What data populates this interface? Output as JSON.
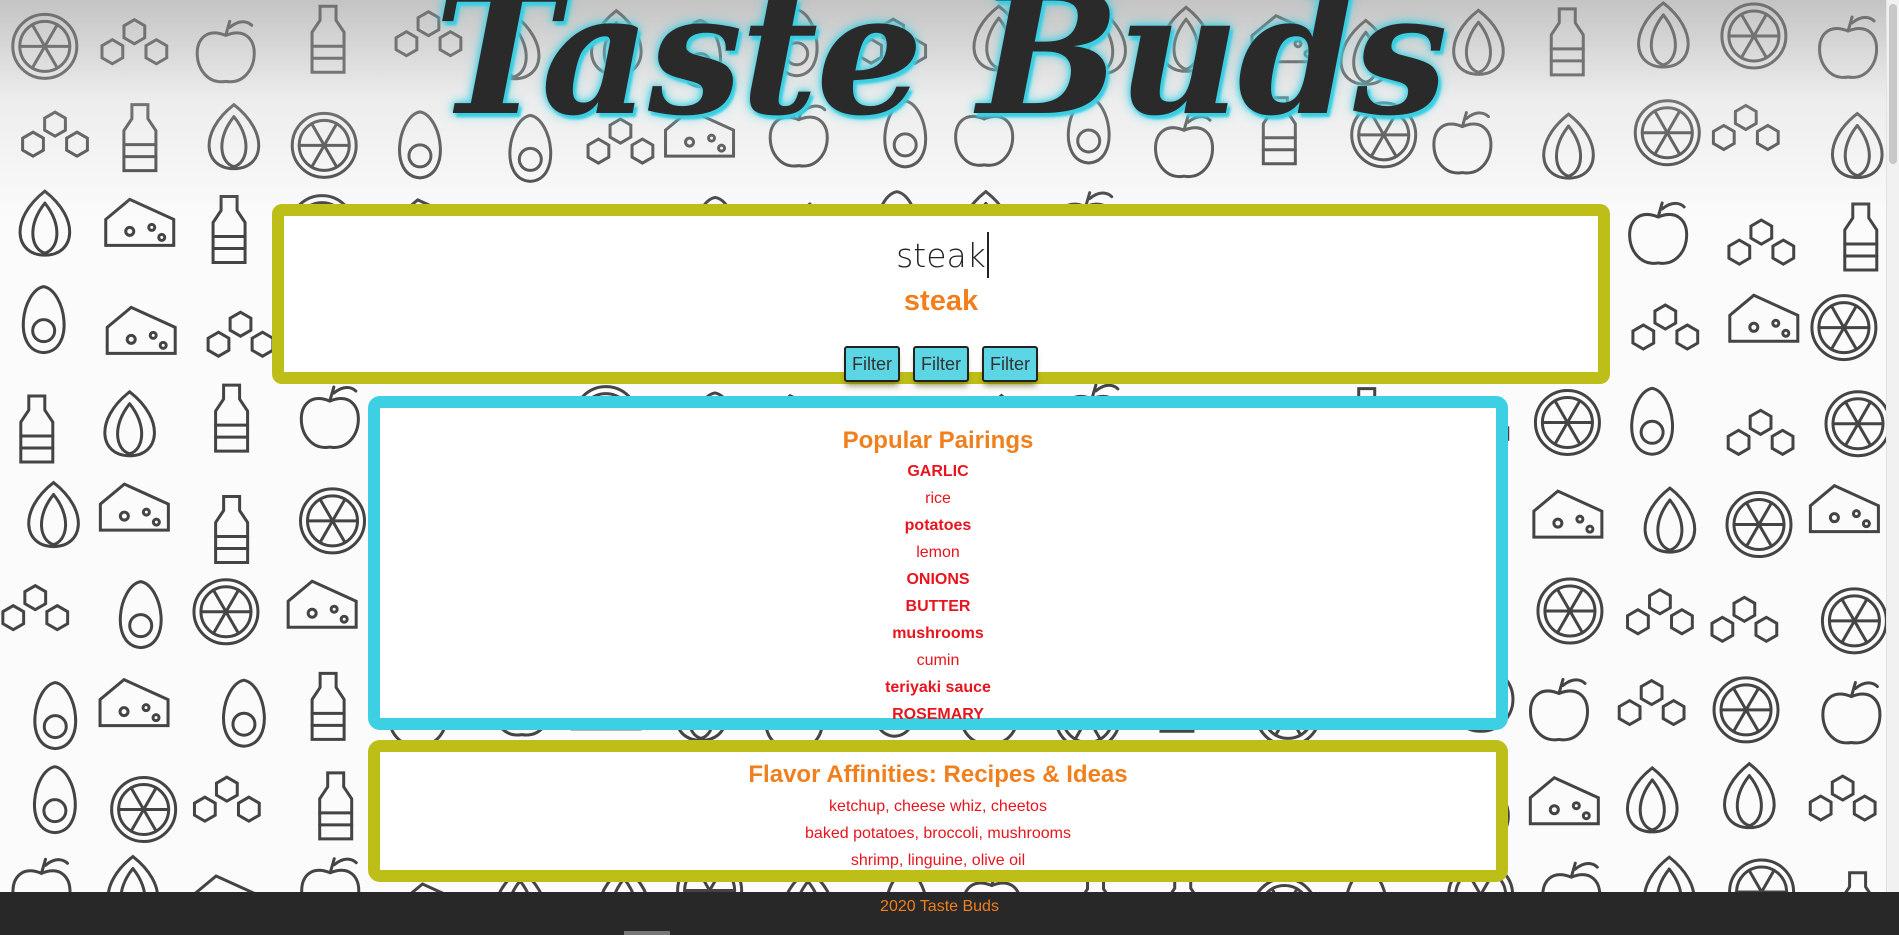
{
  "header": {
    "logo_text": "Taste Buds"
  },
  "search": {
    "input_value": "steak",
    "result_heading": "steak",
    "filters": [
      "Filter",
      "Filter",
      "Filter"
    ]
  },
  "pairings": {
    "title": "Popular Pairings",
    "items": [
      {
        "label": "GARLIC",
        "bold": true
      },
      {
        "label": "rice",
        "bold": false
      },
      {
        "label": "potatoes",
        "bold": true
      },
      {
        "label": "lemon",
        "bold": false
      },
      {
        "label": "ONIONS",
        "bold": true
      },
      {
        "label": "BUTTER",
        "bold": true
      },
      {
        "label": "mushrooms",
        "bold": true
      },
      {
        "label": "cumin",
        "bold": false
      },
      {
        "label": "teriyaki sauce",
        "bold": true
      },
      {
        "label": "ROSEMARY",
        "bold": true
      }
    ]
  },
  "affinities": {
    "title": "Flavor Affinities: Recipes & Ideas",
    "items": [
      "ketchup, cheese whiz, cheetos",
      "baked potatoes, broccoli, mushrooms",
      "shrimp, linguine, olive oil"
    ]
  },
  "footer": {
    "text": "2020 Taste Buds"
  },
  "colors": {
    "accent_orange": "#f07f1d",
    "item_red": "#e8141e",
    "panel_olive": "#bdbe17",
    "panel_cyan": "#3dd0e2",
    "footer_bg": "#282828"
  }
}
